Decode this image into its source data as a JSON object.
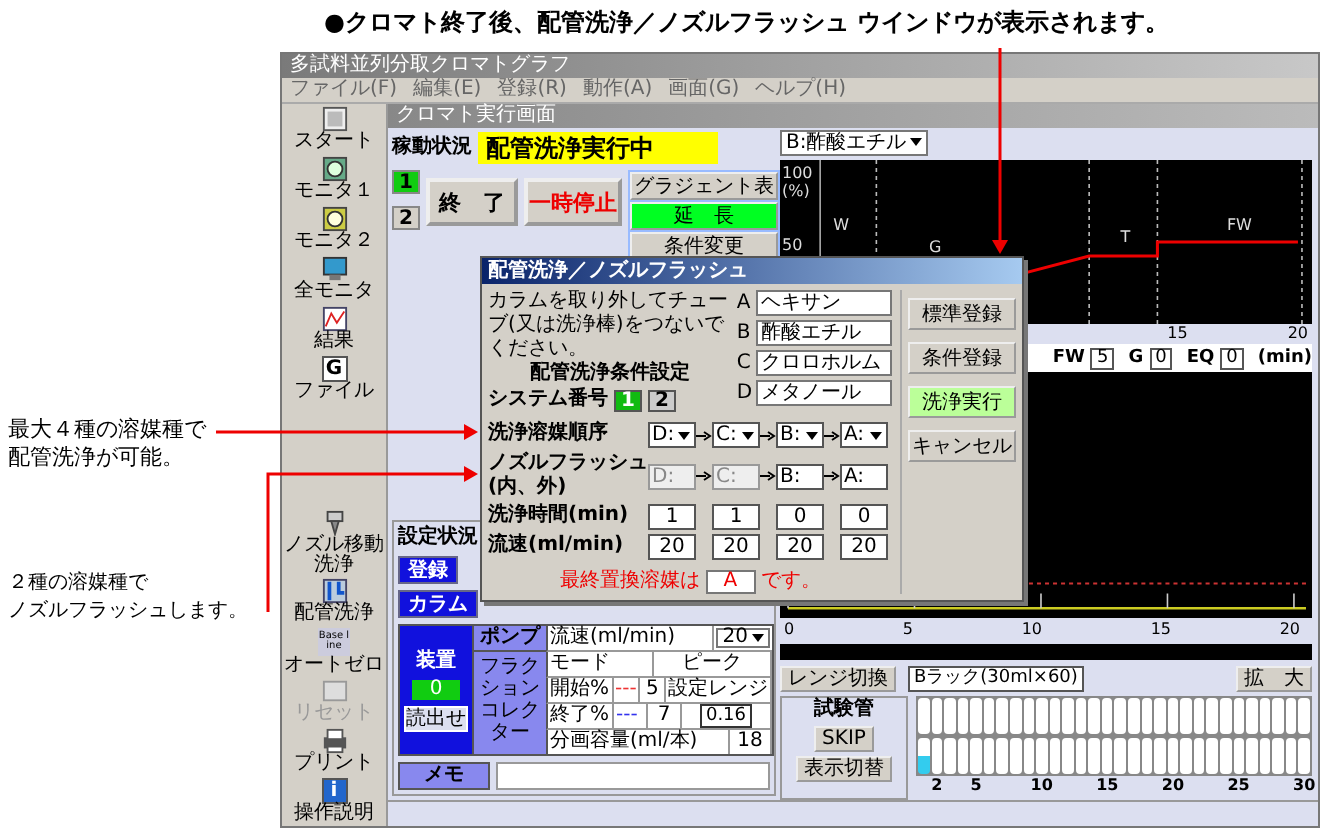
{
  "caption": "●クロマト終了後、配管洗浄／ノズルフラッシュ ウインドウが表示されます。",
  "callouts": [
    {
      "lines": [
        "最大４種の溶媒種で",
        "配管洗浄が可能。"
      ]
    },
    {
      "lines": [
        "２種の溶媒種で",
        "ノズルフラッシュします。"
      ]
    }
  ],
  "window": {
    "title": "多試料並列分取クロマトグラフ",
    "menu": [
      "ファイル(F)",
      "編集(E)",
      "登録(R)",
      "動作(A)",
      "画面(G)",
      "ヘルプ(H)"
    ]
  },
  "toolbar": {
    "upper": [
      {
        "label": "スタート",
        "kind": "start",
        "disabled": false
      },
      {
        "label": "モニタ１",
        "kind": "monitor1",
        "disabled": false
      },
      {
        "label": "モニタ２",
        "kind": "monitor2",
        "disabled": false
      },
      {
        "label": "全モニタ",
        "kind": "all_monitor",
        "disabled": false
      },
      {
        "label": "結果",
        "kind": "result",
        "disabled": false
      },
      {
        "label": "ファイル",
        "kind": "file",
        "icon_text": "G",
        "disabled": false
      }
    ],
    "lower": [
      {
        "label": "ノズル移動洗浄",
        "kind": "nozzle",
        "disabled": false
      },
      {
        "label": "配管洗浄",
        "kind": "pipe",
        "disabled": false
      },
      {
        "label": "オートゼロ",
        "kind": "autozero",
        "icon_text": "Base line",
        "disabled": false
      },
      {
        "label": "リセット",
        "kind": "reset",
        "disabled": true
      },
      {
        "label": "プリント",
        "kind": "print",
        "disabled": false
      },
      {
        "label": "操作説明",
        "kind": "help",
        "icon_text": "i",
        "disabled": false
      }
    ]
  },
  "screen": {
    "title": "クロマト実行画面",
    "status_label": "稼動状況",
    "status": "配管洗浄実行中",
    "systems": [
      {
        "label": "1",
        "selected": true
      },
      {
        "label": "2",
        "selected": false
      }
    ],
    "end_button": "終　了",
    "pause_button": "一時停止",
    "side_buttons": [
      {
        "label": "グラジェント表",
        "highlighted": false
      },
      {
        "label": "延　長",
        "highlighted": true
      },
      {
        "label": "条件変更",
        "highlighted": false
      }
    ],
    "solvent_select": "B:酢酸エチル",
    "gradient_chart": {
      "y_labels": [
        "100",
        "(%)",
        "50"
      ],
      "segments": [
        "W",
        "G",
        "T",
        "FW"
      ],
      "x_labels": [
        "15",
        "20"
      ]
    },
    "times": [
      {
        "label": "FW",
        "value": "5"
      },
      {
        "label": "G",
        "value": "0"
      },
      {
        "label": "EQ",
        "value": "0"
      }
    ],
    "time_unit": "(min)",
    "detector_chart": {
      "x_labels": [
        "0",
        "5",
        "10",
        "15",
        "20"
      ]
    },
    "range_button": "レンジ切換",
    "rack_label": "Bラック(30ml×60)",
    "zoom_button": "拡　大",
    "tubes": {
      "title": "試験管",
      "skip_button": "SKIP",
      "display_button": "表示切替",
      "items": [
        {
          "filled": true
        },
        {
          "label": "2",
          "filled": false
        },
        {
          "filled": false
        },
        {
          "filled": false
        },
        {
          "label": "5",
          "filled": false
        },
        {
          "filled": false
        },
        {
          "filled": false
        },
        {
          "filled": false
        },
        {
          "filled": false
        },
        {
          "label": "10",
          "filled": false
        },
        {
          "filled": false
        },
        {
          "filled": false
        },
        {
          "filled": false
        },
        {
          "filled": false
        },
        {
          "label": "15",
          "filled": false
        },
        {
          "filled": false
        },
        {
          "filled": false
        },
        {
          "filled": false
        },
        {
          "filled": false
        },
        {
          "label": "20",
          "filled": false
        },
        {
          "filled": false
        },
        {
          "filled": false
        },
        {
          "filled": false
        },
        {
          "filled": false
        },
        {
          "label": "25",
          "filled": false
        },
        {
          "filled": false
        },
        {
          "filled": false
        },
        {
          "filled": false
        },
        {
          "filled": false
        },
        {
          "label": "30",
          "filled": false
        }
      ]
    },
    "settings": {
      "title": "設定状況",
      "register_button": "登録",
      "column_button": "カラム",
      "device_label": "装置",
      "device_value": "0",
      "device_button": "読出せ",
      "pump_label": "ポンプ",
      "fraction_label": "フラクションコレクター",
      "flow_label": "流速(ml/min)",
      "flow_value": "20",
      "mode_label": "モード",
      "mode_value": "ピーク",
      "start_label": "開始%",
      "start_dashes": "---",
      "start_value": "5",
      "range_label": "設定レンジ",
      "end_label": "終了%",
      "end_dashes": "---",
      "end_value": "7",
      "range_value": "0.16",
      "volume_label": "分画容量(ml/本)",
      "volume_value": "18",
      "memo_label": "メモ"
    }
  },
  "dialog": {
    "title": "配管洗浄／ノズルフラッシュ",
    "instruction": "カラムを取り外してチューブ(又は洗浄棒)をつないでください。",
    "solvents": [
      {
        "letter": "A",
        "name": "ヘキサン"
      },
      {
        "letter": "B",
        "name": "酢酸エチル"
      },
      {
        "letter": "C",
        "name": "クロロホルム"
      },
      {
        "letter": "D",
        "name": "メタノール"
      }
    ],
    "section_title": "配管洗浄条件設定",
    "system_label": "システム番号",
    "systems": [
      {
        "label": "1",
        "selected": true
      },
      {
        "label": "2",
        "selected": false
      }
    ],
    "order_label": "洗浄溶媒順序",
    "order": [
      "D:",
      "C:",
      "B:",
      "A:"
    ],
    "nozzle_label": "ノズルフラッシュ(内、外)",
    "nozzle": [
      {
        "value": "D:",
        "disabled": true
      },
      {
        "value": "C:",
        "disabled": true
      },
      {
        "value": "B:",
        "disabled": false
      },
      {
        "value": "A:",
        "disabled": false
      }
    ],
    "time_label": "洗浄時間(min)",
    "times": [
      "1",
      "1",
      "0",
      "0"
    ],
    "flow_label": "流速(ml/min)",
    "flows": [
      "20",
      "20",
      "20",
      "20"
    ],
    "final_prefix": "最終置換溶媒は",
    "final_value": "A",
    "final_suffix": "です。",
    "buttons": [
      {
        "label": "標準登録",
        "primary": false
      },
      {
        "label": "条件登録",
        "primary": false
      },
      {
        "label": "洗浄実行",
        "primary": true
      },
      {
        "label": "キャンセル",
        "primary": false
      }
    ]
  }
}
